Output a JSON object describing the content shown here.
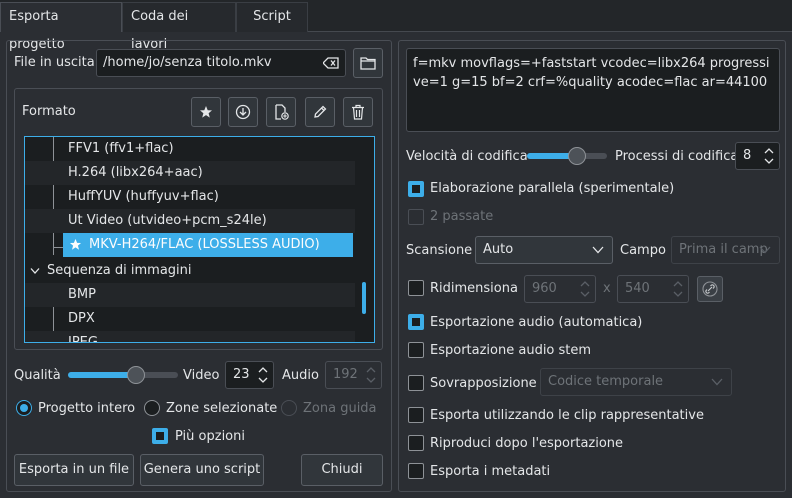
{
  "tabs": [
    "Esporta progetto",
    "Coda dei lavori",
    "Script"
  ],
  "output": {
    "label": "File in uscita",
    "value": "/home/jo/senza titolo.mkv"
  },
  "format": {
    "label": "Formato",
    "tree_items": [
      "FFV1 (ffv1+flac)",
      "H.264 (libx264+aac)",
      "HuffYUV (huffyuv+flac)",
      "Ut Video (utvideo+pcm_s24le)",
      "MKV-H264/FLAC (LOSSLESS AUDIO)",
      "Sequenza di immagini",
      "BMP",
      "DPX",
      "JPEG"
    ]
  },
  "quality": {
    "label": "Qualità",
    "level": 0.62,
    "video_label": "Video",
    "video_value": "23",
    "audio_label": "Audio",
    "audio_value": "192"
  },
  "range": {
    "full": "Progetto intero",
    "selected": "Zone selezionate",
    "guide": "Zona guida"
  },
  "more_options": "Più opzioni",
  "buttons": {
    "export_file": "Esporta in un file",
    "generate_script": "Genera uno script",
    "close": "Chiudi"
  },
  "params": "f=mkv movflags=+faststart vcodec=libx264 progressive=1 g=15 bf=2 crf=%quality acodec=flac ar=44100",
  "encoding": {
    "speed_label": "Velocità di codifica",
    "speed_level": 0.62,
    "threads_label": "Processi di codifica",
    "threads_value": "8"
  },
  "parallel": "Elaborazione parallela (sperimentale)",
  "two_pass": "2 passate",
  "scan": {
    "label": "Scansione",
    "value": "Auto"
  },
  "field": {
    "label": "Campo",
    "value": "Prima il camp"
  },
  "resize": {
    "label": "Ridimensiona",
    "width": "960",
    "x": "x",
    "height": "540"
  },
  "audio_export": "Esportazione audio (automatica)",
  "stem_export": "Esportazione audio stem",
  "overlay": {
    "label": "Sovrapposizione",
    "value": "Codice temporale"
  },
  "use_proxy": "Esporta utilizzando le clip rappresentative",
  "play_after": "Riproduci dopo l'esportazione",
  "metadata": "Esporta i metadati",
  "colors": {
    "accent": "#3daee9",
    "bg": "#2b2e33",
    "field_bg": "#1b1e20"
  }
}
